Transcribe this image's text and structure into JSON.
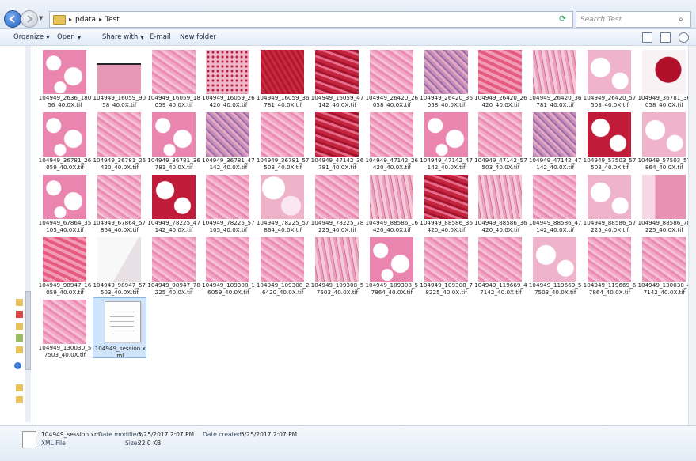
{
  "address": {
    "crumbs": [
      "pdata",
      "Test"
    ],
    "search_placeholder": "Search Test"
  },
  "toolbar": {
    "organize": "Organize",
    "open": "Open",
    "share_with": "Share with",
    "email": "E-mail",
    "new_folder": "New folder"
  },
  "files": [
    {
      "name": "104949_2636_18056_40.0X.tif",
      "kind": "fat"
    },
    {
      "name": "104949_16059_9058_40.0X.tif",
      "kind": "edge"
    },
    {
      "name": "104949_16059_18059_40.0X.tif",
      "kind": "pink"
    },
    {
      "name": "104949_16059_26420_40.0X.tif",
      "kind": "spotted"
    },
    {
      "name": "104949_16059_36781_40.0X.tif",
      "kind": "red"
    },
    {
      "name": "104949_16059_47142_40.0X.tif",
      "kind": "redmix"
    },
    {
      "name": "104949_26420_26058_40.0X.tif",
      "kind": "pink"
    },
    {
      "name": "104949_26420_36058_40.0X.tif",
      "kind": "purple"
    },
    {
      "name": "104949_26420_26420_40.0X.tif",
      "kind": "pinkred"
    },
    {
      "name": "104949_26420_36781_40.0X.tif",
      "kind": "stroma"
    },
    {
      "name": "104949_26420_57503_40.0X.tif",
      "kind": "fatlight"
    },
    {
      "name": "104949_36781_36058_40.0X.tif",
      "kind": "redwhite"
    },
    {
      "name": "104949_36781_26059_40.0X.tif",
      "kind": "fat"
    },
    {
      "name": "104949_36781_26420_40.0X.tif",
      "kind": "pink"
    },
    {
      "name": "104949_36781_36781_40.0X.tif",
      "kind": "fat"
    },
    {
      "name": "104949_36781_47142_40.0X.tif",
      "kind": "purple"
    },
    {
      "name": "104949_36781_57503_40.0X.tif",
      "kind": "pink"
    },
    {
      "name": "104949_47142_36781_40.0X.tif",
      "kind": "redmix"
    },
    {
      "name": "104949_47142_26420_40.0X.tif",
      "kind": "pink"
    },
    {
      "name": "104949_47142_47142_40.0X.tif",
      "kind": "fat"
    },
    {
      "name": "104949_47142_57503_40.0X.tif",
      "kind": "pink"
    },
    {
      "name": "104949_47142_47142_40.0X.tif",
      "kind": "purple"
    },
    {
      "name": "104949_57503_57503_40.0X.tif",
      "kind": "fatred"
    },
    {
      "name": "104949_57503_57864_40.0X.tif",
      "kind": "fatlight"
    },
    {
      "name": "104949_67864_35105_40.0X.tif",
      "kind": "fat"
    },
    {
      "name": "104949_67864_57864_40.0X.tif",
      "kind": "pink"
    },
    {
      "name": "104949_78225_47142_40.0X.tif",
      "kind": "fatred"
    },
    {
      "name": "104949_78225_57105_40.0X.tif",
      "kind": "pink"
    },
    {
      "name": "104949_78225_57864_40.0X.tif",
      "kind": "whitepink"
    },
    {
      "name": "104949_78225_78225_40.0X.tif",
      "kind": "pink"
    },
    {
      "name": "104949_88586_16420_40.0X.tif",
      "kind": "stroma"
    },
    {
      "name": "104949_88586_36420_40.0X.tif",
      "kind": "redmix"
    },
    {
      "name": "104949_88586_36420_40.0X.tif",
      "kind": "stroma"
    },
    {
      "name": "104949_88586_47142_40.0X.tif",
      "kind": "pink"
    },
    {
      "name": "104949_88586_57225_40.0X.tif",
      "kind": "fatlight"
    },
    {
      "name": "104949_88586_78225_40.0X.tif",
      "kind": "edgepink"
    },
    {
      "name": "104949_98947_16059_40.0X.tif",
      "kind": "pinkred"
    },
    {
      "name": "104949_98947_57503_40.0X.tif",
      "kind": "white"
    },
    {
      "name": "104949_98947_78225_40.0X.tif",
      "kind": "pink"
    },
    {
      "name": "104949_109308_16059_40.0X.tif",
      "kind": "pink"
    },
    {
      "name": "104949_109308_26420_40.0X.tif",
      "kind": "pink"
    },
    {
      "name": "104949_109308_57503_40.0X.tif",
      "kind": "stroma"
    },
    {
      "name": "104949_109308_57864_40.0X.tif",
      "kind": "fat"
    },
    {
      "name": "104949_109308_78225_40.0X.tif",
      "kind": "pink"
    },
    {
      "name": "104949_119669_47142_40.0X.tif",
      "kind": "pink"
    },
    {
      "name": "104949_119669_57503_40.0X.tif",
      "kind": "fatlight"
    },
    {
      "name": "104949_119669_67864_40.0X.tif",
      "kind": "pink"
    },
    {
      "name": "104949_130030_47142_40.0X.tif",
      "kind": "pink"
    },
    {
      "name": "104949_130030_57503_40.0X.tif",
      "kind": "pink"
    },
    {
      "name": "104949_session.xml",
      "kind": "xml"
    }
  ],
  "details": {
    "filename": "104949_session.xml",
    "filetype": "XML File",
    "date_modified_label": "Date modified:",
    "date_modified": "5/25/2017 2:07 PM",
    "size_label": "Size:",
    "size": "22.0 KB",
    "date_created_label": "Date created:",
    "date_created": "5/25/2017 2:07 PM"
  }
}
